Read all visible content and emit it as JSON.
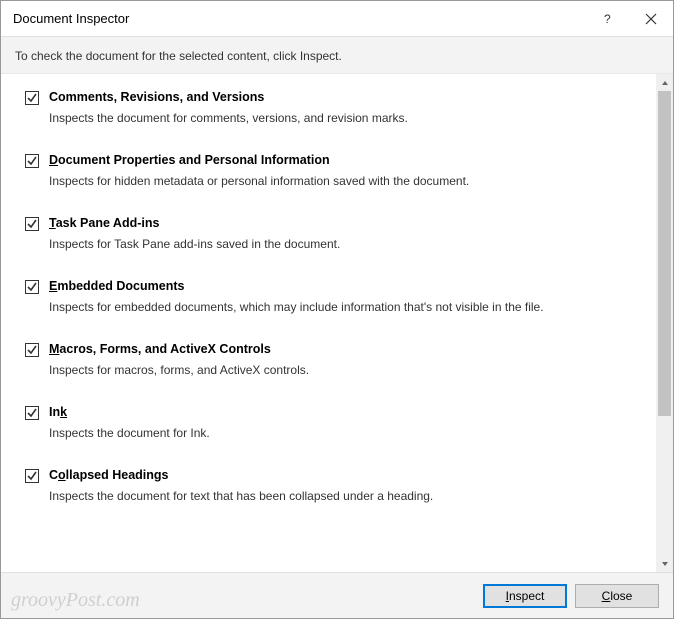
{
  "dialog": {
    "title": "Document Inspector",
    "instruction": "To check the document for the selected content, click Inspect."
  },
  "items": [
    {
      "checked": true,
      "title_pre": "",
      "title_ul": "",
      "title_post": "Comments, Revisions, and Versions",
      "desc": "Inspects the document for comments, versions, and revision marks."
    },
    {
      "checked": true,
      "title_pre": "",
      "title_ul": "D",
      "title_post": "ocument Properties and Personal Information",
      "desc": "Inspects for hidden metadata or personal information saved with the document."
    },
    {
      "checked": true,
      "title_pre": "",
      "title_ul": "T",
      "title_post": "ask Pane Add-ins",
      "desc": "Inspects for Task Pane add-ins saved in the document."
    },
    {
      "checked": true,
      "title_pre": "",
      "title_ul": "E",
      "title_post": "mbedded Documents",
      "desc": "Inspects for embedded documents, which may include information that's not visible in the file."
    },
    {
      "checked": true,
      "title_pre": "",
      "title_ul": "M",
      "title_post": "acros, Forms, and ActiveX Controls",
      "desc": "Inspects for macros, forms, and ActiveX controls."
    },
    {
      "checked": true,
      "title_pre": "In",
      "title_ul": "k",
      "title_post": "",
      "desc": "Inspects the document for Ink."
    },
    {
      "checked": true,
      "title_pre": "C",
      "title_ul": "o",
      "title_post": "llapsed Headings",
      "desc": "Inspects the document for text that has been collapsed under a heading."
    }
  ],
  "buttons": {
    "inspect_ul": "I",
    "inspect_post": "nspect",
    "close_ul": "C",
    "close_post": "lose"
  },
  "watermark": "groovyPost.com"
}
